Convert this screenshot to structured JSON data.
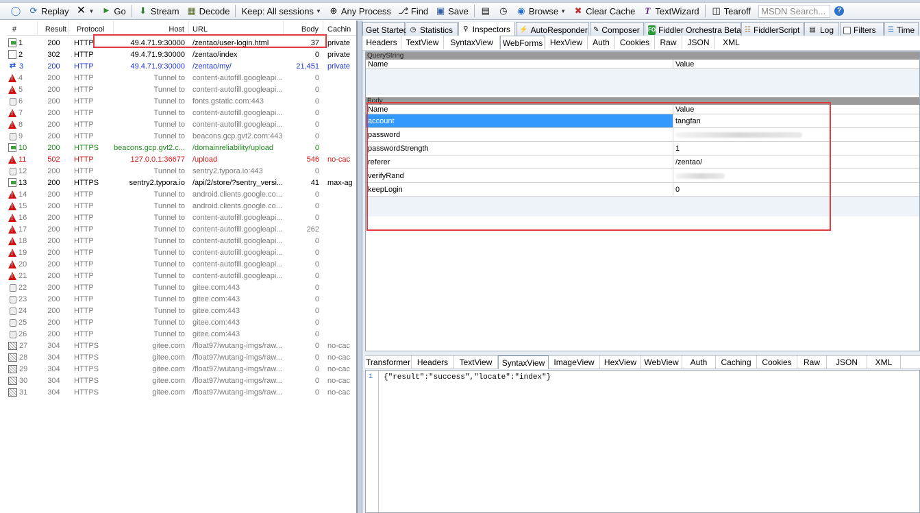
{
  "toolbar": {
    "replay": "Replay",
    "go": "Go",
    "stream": "Stream",
    "decode": "Decode",
    "keep": "Keep: All sessions",
    "process": "Any Process",
    "find": "Find",
    "save": "Save",
    "browse": "Browse",
    "clear_cache": "Clear Cache",
    "textwizard": "TextWizard",
    "tearoff": "Tearoff",
    "msdn": "MSDN Search..."
  },
  "list": {
    "headers": [
      "#",
      "Result",
      "Protocol",
      "Host",
      "URL",
      "Body",
      "Cachin"
    ],
    "rows": [
      {
        "id": "1",
        "icon": "doc-green",
        "result": "200",
        "protocol": "HTTP",
        "host": "49.4.71.9:30000",
        "url": "/zentao/user-login.html",
        "body": "37",
        "cache": "private",
        "color": "black"
      },
      {
        "id": "2",
        "icon": "doc-302",
        "result": "302",
        "protocol": "HTTP",
        "host": "49.4.71.9:30000",
        "url": "/zentao/index",
        "body": "0",
        "cache": "private",
        "color": "black"
      },
      {
        "id": "3",
        "icon": "arrows",
        "result": "200",
        "protocol": "HTTP",
        "host": "49.4.71.9:30000",
        "url": "/zentao/my/",
        "body": "21,451",
        "cache": "private",
        "color": "blue"
      },
      {
        "id": "4",
        "icon": "warn",
        "result": "200",
        "protocol": "HTTP",
        "host": "Tunnel to",
        "url": "content-autofill.googleapi...",
        "body": "0",
        "cache": "",
        "color": "gray"
      },
      {
        "id": "5",
        "icon": "warn",
        "result": "200",
        "protocol": "HTTP",
        "host": "Tunnel to",
        "url": "content-autofill.googleapi...",
        "body": "0",
        "cache": "",
        "color": "gray"
      },
      {
        "id": "6",
        "icon": "lock",
        "result": "200",
        "protocol": "HTTP",
        "host": "Tunnel to",
        "url": "fonts.gstatic.com:443",
        "body": "0",
        "cache": "",
        "color": "gray"
      },
      {
        "id": "7",
        "icon": "warn",
        "result": "200",
        "protocol": "HTTP",
        "host": "Tunnel to",
        "url": "content-autofill.googleapi...",
        "body": "0",
        "cache": "",
        "color": "gray"
      },
      {
        "id": "8",
        "icon": "warn",
        "result": "200",
        "protocol": "HTTP",
        "host": "Tunnel to",
        "url": "content-autofill.googleapi...",
        "body": "0",
        "cache": "",
        "color": "gray"
      },
      {
        "id": "9",
        "icon": "lock",
        "result": "200",
        "protocol": "HTTP",
        "host": "Tunnel to",
        "url": "beacons.gcp.gvt2.com:443",
        "body": "0",
        "cache": "",
        "color": "gray"
      },
      {
        "id": "10",
        "icon": "doc-green",
        "result": "200",
        "protocol": "HTTPS",
        "host": "beacons.gcp.gvt2.c...",
        "url": "/domainreliability/upload",
        "body": "0",
        "cache": "",
        "color": "green"
      },
      {
        "id": "11",
        "icon": "warn",
        "result": "502",
        "protocol": "HTTP",
        "host": "127.0.0.1:36677",
        "url": "/upload",
        "body": "546",
        "cache": "no-cac",
        "color": "red"
      },
      {
        "id": "12",
        "icon": "lock",
        "result": "200",
        "protocol": "HTTP",
        "host": "Tunnel to",
        "url": "sentry2.typora.io:443",
        "body": "0",
        "cache": "",
        "color": "gray"
      },
      {
        "id": "13",
        "icon": "doc-green",
        "result": "200",
        "protocol": "HTTPS",
        "host": "sentry2.typora.io",
        "url": "/api/2/store/?sentry_versi...",
        "body": "41",
        "cache": "max-ag",
        "color": "black"
      },
      {
        "id": "14",
        "icon": "warn",
        "result": "200",
        "protocol": "HTTP",
        "host": "Tunnel to",
        "url": "android.clients.google.co...",
        "body": "0",
        "cache": "",
        "color": "gray"
      },
      {
        "id": "15",
        "icon": "warn",
        "result": "200",
        "protocol": "HTTP",
        "host": "Tunnel to",
        "url": "android.clients.google.co...",
        "body": "0",
        "cache": "",
        "color": "gray"
      },
      {
        "id": "16",
        "icon": "warn",
        "result": "200",
        "protocol": "HTTP",
        "host": "Tunnel to",
        "url": "content-autofill.googleapi...",
        "body": "0",
        "cache": "",
        "color": "gray"
      },
      {
        "id": "17",
        "icon": "warn",
        "result": "200",
        "protocol": "HTTP",
        "host": "Tunnel to",
        "url": "content-autofill.googleapi...",
        "body": "262",
        "cache": "",
        "color": "gray"
      },
      {
        "id": "18",
        "icon": "warn",
        "result": "200",
        "protocol": "HTTP",
        "host": "Tunnel to",
        "url": "content-autofill.googleapi...",
        "body": "0",
        "cache": "",
        "color": "gray"
      },
      {
        "id": "19",
        "icon": "warn",
        "result": "200",
        "protocol": "HTTP",
        "host": "Tunnel to",
        "url": "content-autofill.googleapi...",
        "body": "0",
        "cache": "",
        "color": "gray"
      },
      {
        "id": "20",
        "icon": "warn",
        "result": "200",
        "protocol": "HTTP",
        "host": "Tunnel to",
        "url": "content-autofill.googleapi...",
        "body": "0",
        "cache": "",
        "color": "gray"
      },
      {
        "id": "21",
        "icon": "warn",
        "result": "200",
        "protocol": "HTTP",
        "host": "Tunnel to",
        "url": "content-autofill.googleapi...",
        "body": "0",
        "cache": "",
        "color": "gray"
      },
      {
        "id": "22",
        "icon": "lock",
        "result": "200",
        "protocol": "HTTP",
        "host": "Tunnel to",
        "url": "gitee.com:443",
        "body": "0",
        "cache": "",
        "color": "gray"
      },
      {
        "id": "23",
        "icon": "lock",
        "result": "200",
        "protocol": "HTTP",
        "host": "Tunnel to",
        "url": "gitee.com:443",
        "body": "0",
        "cache": "",
        "color": "gray"
      },
      {
        "id": "24",
        "icon": "lock",
        "result": "200",
        "protocol": "HTTP",
        "host": "Tunnel to",
        "url": "gitee.com:443",
        "body": "0",
        "cache": "",
        "color": "gray"
      },
      {
        "id": "25",
        "icon": "lock",
        "result": "200",
        "protocol": "HTTP",
        "host": "Tunnel to",
        "url": "gitee.com:443",
        "body": "0",
        "cache": "",
        "color": "gray"
      },
      {
        "id": "26",
        "icon": "lock",
        "result": "200",
        "protocol": "HTTP",
        "host": "Tunnel to",
        "url": "gitee.com:443",
        "body": "0",
        "cache": "",
        "color": "gray"
      },
      {
        "id": "27",
        "icon": "pkg",
        "result": "304",
        "protocol": "HTTPS",
        "host": "gitee.com",
        "url": "/float97/wutang-imgs/raw...",
        "body": "0",
        "cache": "no-cac",
        "color": "gray"
      },
      {
        "id": "28",
        "icon": "pkg",
        "result": "304",
        "protocol": "HTTPS",
        "host": "gitee.com",
        "url": "/float97/wutang-imgs/raw...",
        "body": "0",
        "cache": "no-cac",
        "color": "gray"
      },
      {
        "id": "29",
        "icon": "pkg",
        "result": "304",
        "protocol": "HTTPS",
        "host": "gitee.com",
        "url": "/float97/wutang-imgs/raw...",
        "body": "0",
        "cache": "no-cac",
        "color": "gray"
      },
      {
        "id": "30",
        "icon": "pkg",
        "result": "304",
        "protocol": "HTTPS",
        "host": "gitee.com",
        "url": "/float97/wutang-imgs/raw...",
        "body": "0",
        "cache": "no-cac",
        "color": "gray"
      },
      {
        "id": "31",
        "icon": "pkg",
        "result": "304",
        "protocol": "HTTPS",
        "host": "gitee.com",
        "url": "/float97/wutang-imgs/raw...",
        "body": "0",
        "cache": "no-cac",
        "color": "gray"
      }
    ]
  },
  "main_tabs": [
    "Get Started",
    "Statistics",
    "Inspectors",
    "AutoResponder",
    "Composer",
    "Fiddler Orchestra Beta",
    "FiddlerScript",
    "Log",
    "Filters",
    "Time"
  ],
  "request_tabs": [
    "Headers",
    "TextView",
    "SyntaxView",
    "WebForms",
    "HexView",
    "Auth",
    "Cookies",
    "Raw",
    "JSON",
    "XML"
  ],
  "querystring": {
    "title": "QueryString",
    "col_name": "Name",
    "col_value": "Value"
  },
  "body": {
    "title": "Body",
    "col_name": "Name",
    "col_value": "Value",
    "rows": [
      {
        "name": "account",
        "value": "tangfan"
      },
      {
        "name": "password",
        "value": ""
      },
      {
        "name": "passwordStrength",
        "value": "1"
      },
      {
        "name": "referer",
        "value": "/zentao/"
      },
      {
        "name": "verifyRand",
        "value": ""
      },
      {
        "name": "keepLogin",
        "value": "0"
      }
    ]
  },
  "response_tabs": [
    "Transformer",
    "Headers",
    "TextView",
    "SyntaxView",
    "ImageView",
    "HexView",
    "WebView",
    "Auth",
    "Caching",
    "Cookies",
    "Raw",
    "JSON",
    "XML"
  ],
  "response": {
    "line": "1",
    "text": "{\"result\":\"success\",\"locate\":\"index\"}"
  },
  "colors": {
    "highlight_box": "#e23a3a",
    "selected_row": "#3399ff"
  }
}
